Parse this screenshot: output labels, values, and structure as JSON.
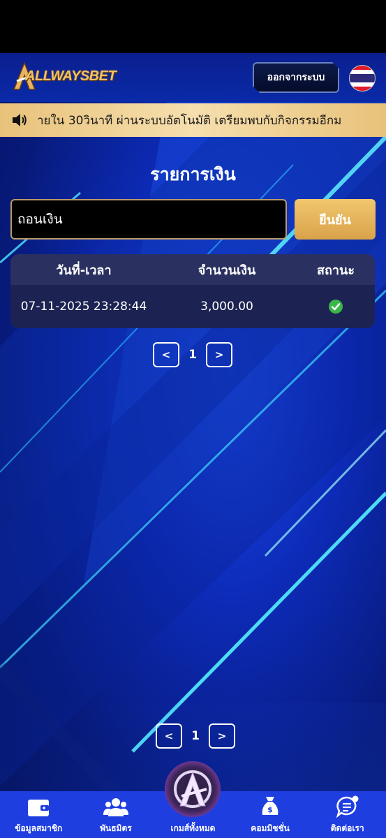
{
  "header": {
    "logo_text": "ALLWAYSBET",
    "logout_label": "ออกจากระบบ",
    "language_flag": "thailand-flag"
  },
  "announcement": {
    "text": "ายใน 30วินาที ผ่านระบบอัตโนมัติ เตรียมพบกับกิจกรรมอีกม"
  },
  "page": {
    "title": "รายการเงิน"
  },
  "filter": {
    "selected_type": "ถอนเงิน",
    "confirm_label": "ยืนยัน"
  },
  "table": {
    "columns": [
      "วันที่-เวลา",
      "จำนวนเงิน",
      "สถานะ"
    ],
    "rows": [
      {
        "datetime": "07-11-2025 23:28:44",
        "amount": "3,000.00",
        "status": "success"
      }
    ]
  },
  "pagination_top": {
    "prev": "<",
    "page": "1",
    "next": ">"
  },
  "pagination_bottom": {
    "prev": "<",
    "page": "1",
    "next": ">"
  },
  "bottom_nav": {
    "items": [
      {
        "label": "ข้อมูลสมาชิก",
        "icon": "wallet-icon"
      },
      {
        "label": "พันธมิตร",
        "icon": "users-icon"
      },
      {
        "label": "เกมส์ทั้งหมด",
        "icon": "avengers-logo-icon"
      },
      {
        "label": "คอมมิชชั่น",
        "icon": "money-bag-icon"
      },
      {
        "label": "ติดต่อเรา",
        "icon": "chat-icon"
      }
    ]
  },
  "colors": {
    "accent_gold": "#e8b65c",
    "nav_blue": "#1f3ee0",
    "success_green": "#3ab54a"
  }
}
